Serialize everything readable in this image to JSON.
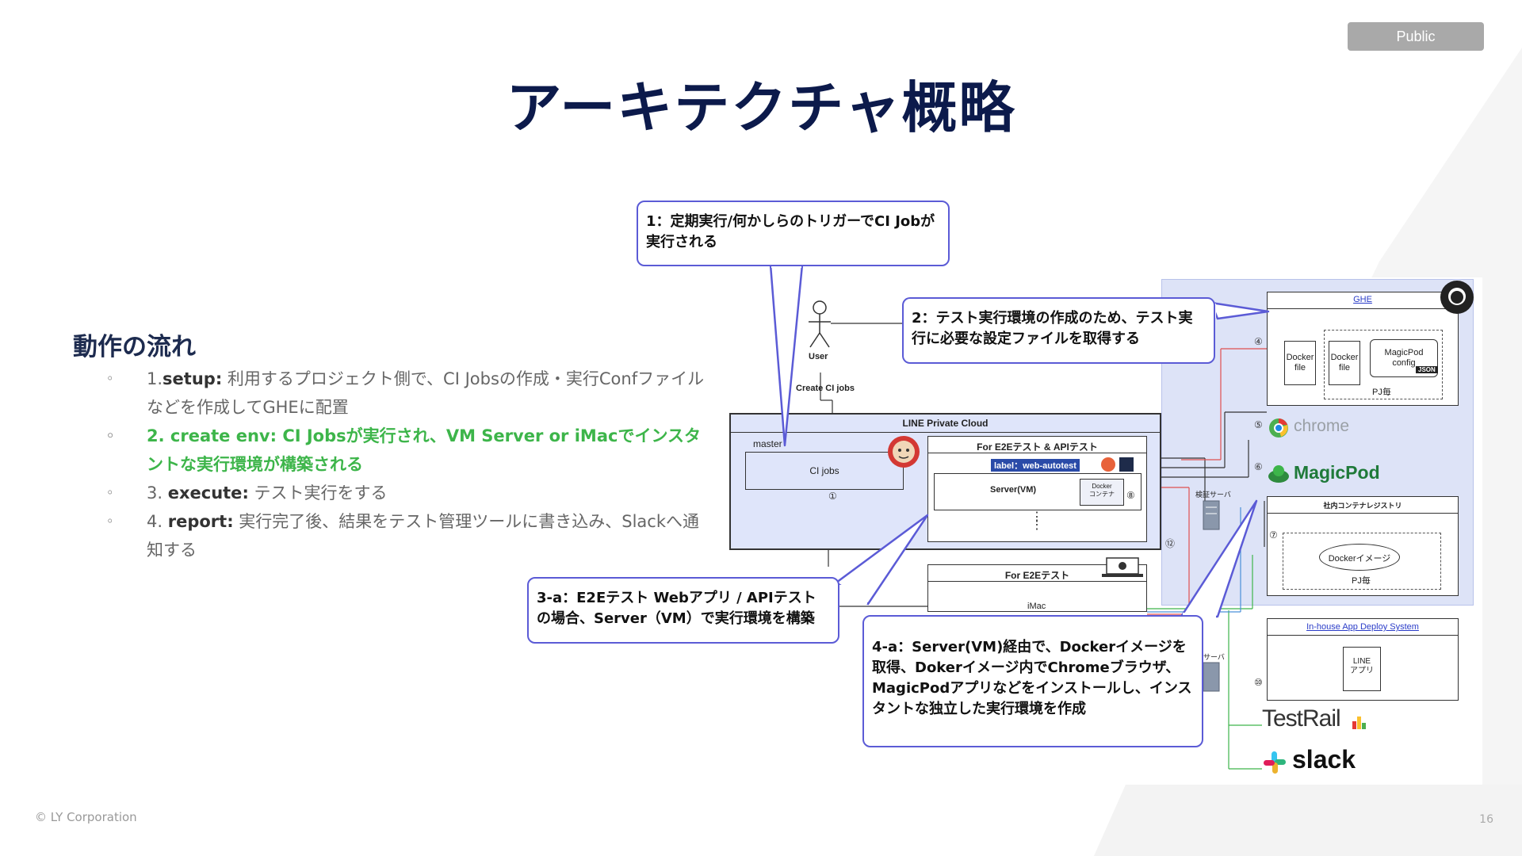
{
  "badge": "Public",
  "title": "アーキテクチャ概略",
  "flow": {
    "heading": "動作の流れ",
    "bullet": "◦",
    "steps": [
      {
        "num": "1.",
        "key": "setup",
        "colon": ":",
        "text": " 利用するプロジェクト側で、CI Jobsの作成・実行Confファイルなどを作成してGHEに配置"
      },
      {
        "num": "2. ",
        "key": "create env",
        "colon": ":",
        "text": " CI Jobsが実行され、VM Server or iMacでインスタントな実行環境が構築される"
      },
      {
        "num": "3. ",
        "key": "execute",
        "colon": ":",
        "text": " テスト実行をする"
      },
      {
        "num": "4. ",
        "key": "report",
        "colon": ":",
        "text": " 実行完了後、結果をテスト管理ツールに書き込み、Slackへ通知する"
      }
    ]
  },
  "callouts": {
    "c1": "1：定期実行/何かしらのトリガーでCI Jobが実行される",
    "c2": "2：テスト実行環境の作成のため、テスト実行に必要な設定ファイルを取得する",
    "c3a": "3-a：E2Eテスト Webアプリ / APIテストの場合、Server（VM）で実行環境を構築",
    "c4a": "4-a：Server(VM)経由で、Dockerイメージを取得、Dokerイメージ内でChromeブラウザ、MagicPodアプリなどをインストールし、インスタントな独立した実行環境を作成"
  },
  "diagram": {
    "user": "User",
    "create_ci_jobs": "Create CI jobs",
    "line_private_cloud": "LINE Private Cloud",
    "master": "master",
    "ci_jobs": "CI jobs",
    "for_e2e_api": "For E2Eテスト & APIテスト",
    "label_tag": "label：web-autotest",
    "server_vm": "Server(VM)",
    "docker_container": "Docker\nコンテナ",
    "kensho_server": "検証サーバ",
    "for_e2e": "For E2Eテスト",
    "imac": "iMac",
    "server_short": "サーバ",
    "ghe": "GHE",
    "docker_file_1": "Docker\nfile",
    "docker_file_2": "Docker\nfile",
    "magicpod_config": "MagicPod\nconfig",
    "json": "JSON",
    "pj_each_1": "PJ毎",
    "chrome": "chrome",
    "magicpod": "MagicPod",
    "registry": "社内コンテナレジストリ",
    "docker_image": "Dockerイメージ",
    "pj_each_2": "PJ毎",
    "deploy_system": "In-house App Deploy System",
    "line_app": "LINE\nアプリ",
    "testrail": "TestRail",
    "slack": "slack",
    "nums": [
      "①",
      "④",
      "⑤",
      "⑥",
      "⑦",
      "⑧",
      "⑩",
      "⑫"
    ]
  },
  "footer": {
    "copyright": "© LY Corporation",
    "page": "16"
  }
}
